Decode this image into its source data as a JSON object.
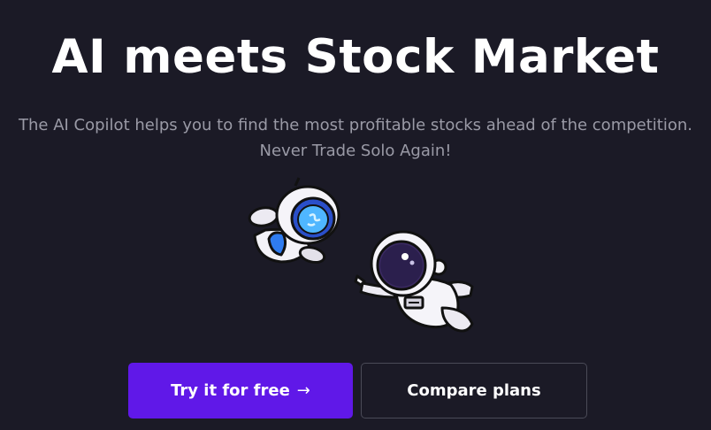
{
  "hero": {
    "headline": "AI meets Stock Market",
    "subtitle_line1": "The AI Copilot helps you to find the most profitable stocks ahead of the competition.",
    "subtitle_line2": "Never Trade Solo Again!"
  },
  "illustration": {
    "name": "astronauts-illustration"
  },
  "cta": {
    "primary_label": "Try it for free",
    "primary_arrow": "→",
    "secondary_label": "Compare plans"
  },
  "colors": {
    "background": "#1b1a26",
    "primary_button": "#6018e8",
    "subtitle": "#9a9aa6",
    "secondary_border": "#4a4a57"
  }
}
